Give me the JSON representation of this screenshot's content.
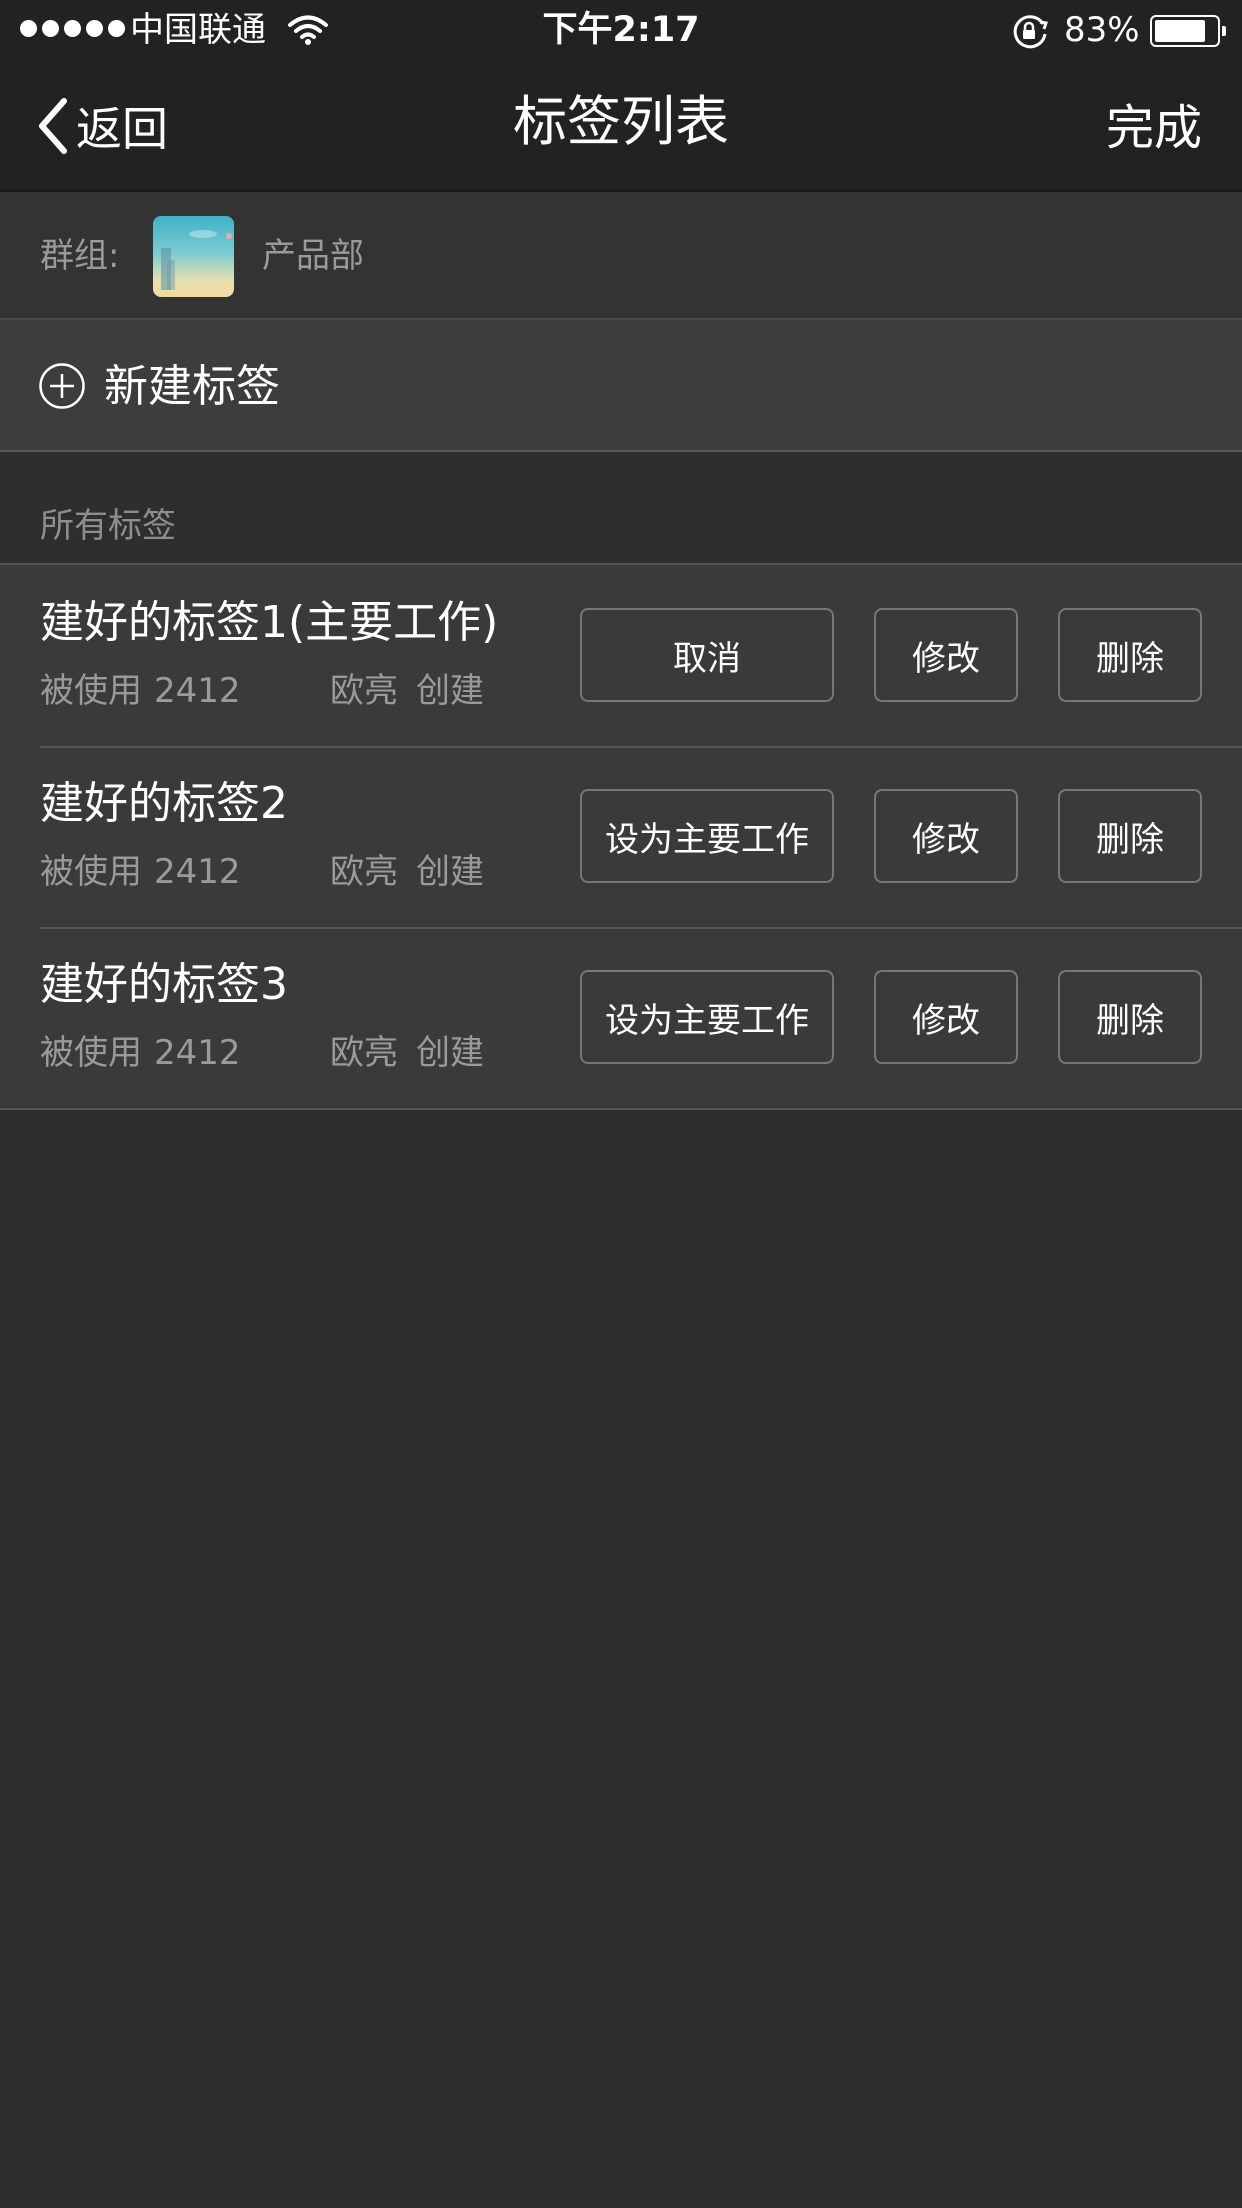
{
  "status_bar": {
    "carrier": "中国联通",
    "time": "下午2:17",
    "battery_percent": "83%",
    "battery_level": 0.83,
    "icons": [
      "signal-dots",
      "wifi-icon",
      "rotation-lock-icon",
      "battery-icon"
    ]
  },
  "nav": {
    "back_label": "返回",
    "title": "标签列表",
    "done_label": "完成"
  },
  "group": {
    "label": "群组:",
    "name": "产品部"
  },
  "new_tag": {
    "label": "新建标签"
  },
  "section": {
    "title": "所有标签"
  },
  "tags": [
    {
      "name": "建好的标签1(主要工作)",
      "usage_label": "被使用",
      "usage_count": "2412",
      "creator": "欧亮",
      "created_label": "创建",
      "primary_action": "取消",
      "edit_label": "修改",
      "delete_label": "删除"
    },
    {
      "name": "建好的标签2",
      "usage_label": "被使用",
      "usage_count": "2412",
      "creator": "欧亮",
      "created_label": "创建",
      "primary_action": "设为主要工作",
      "edit_label": "修改",
      "delete_label": "删除"
    },
    {
      "name": "建好的标签3",
      "usage_label": "被使用",
      "usage_count": "2412",
      "creator": "欧亮",
      "created_label": "创建",
      "primary_action": "设为主要工作",
      "edit_label": "修改",
      "delete_label": "删除"
    }
  ]
}
